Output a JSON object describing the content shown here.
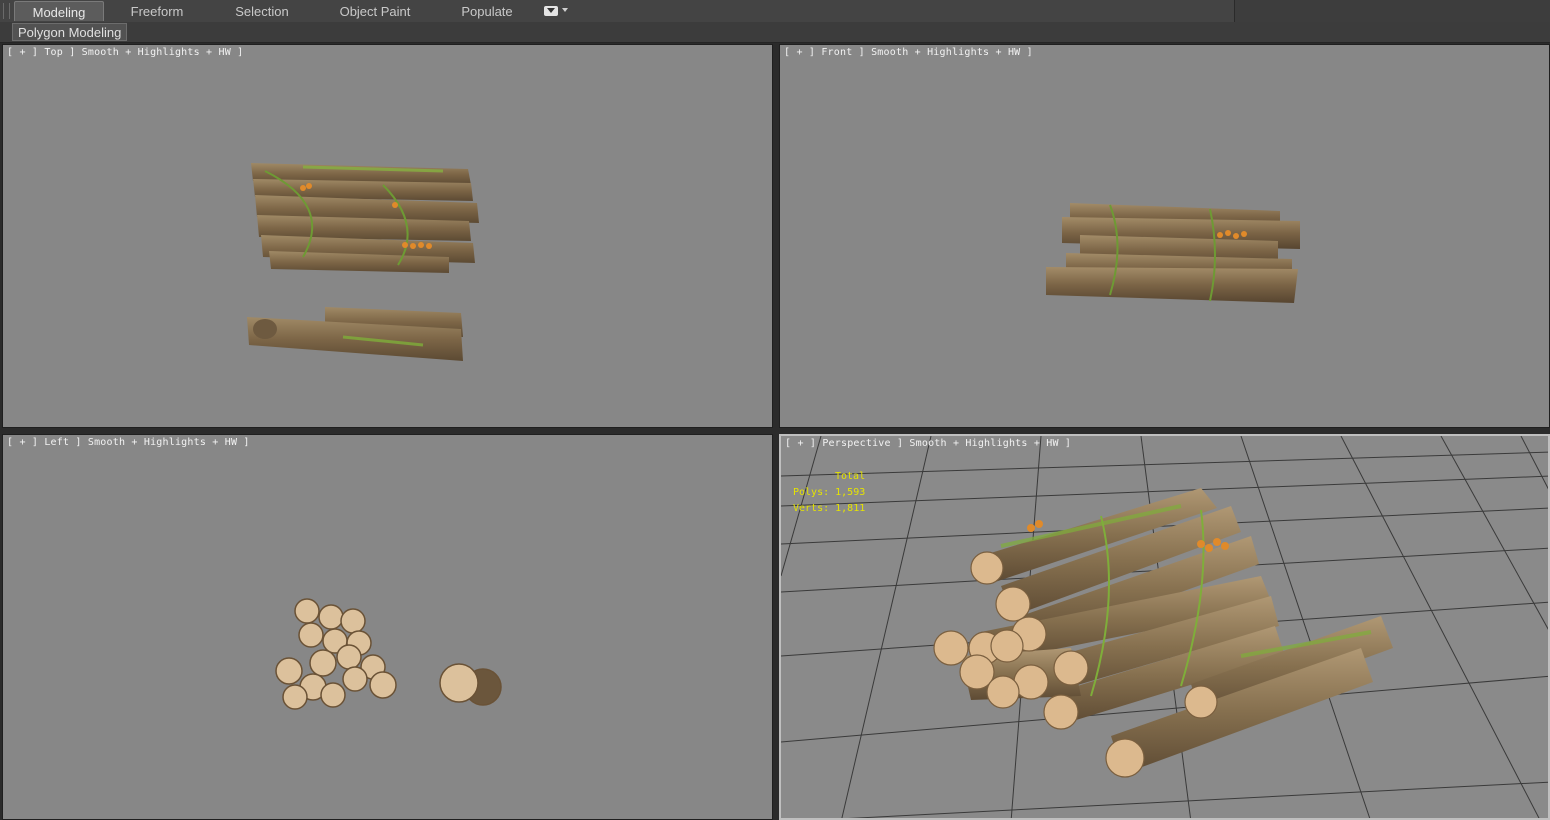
{
  "ribbon": {
    "tabs": [
      {
        "label": "Modeling",
        "active": true
      },
      {
        "label": "Freeform",
        "active": false
      },
      {
        "label": "Selection",
        "active": false
      },
      {
        "label": "Object Paint",
        "active": false
      },
      {
        "label": "Populate",
        "active": false
      }
    ],
    "dropdown_icon": "dropdown-toggle-icon"
  },
  "panel": {
    "label": "Polygon Modeling"
  },
  "viewports": {
    "top": {
      "label": "[ + ] Top ] Smooth + Highlights + HW ]"
    },
    "front": {
      "label": "[ + ] Front ] Smooth + Highlights + HW ]"
    },
    "left": {
      "label": "[ + ] Left ] Smooth + Highlights + HW ]"
    },
    "perspective": {
      "label": "[ + ] Perspective ] Smooth + Highlights + HW ]",
      "stats": {
        "title": "Total",
        "polys": "Polys: 1,593",
        "verts": "Verts: 1,811"
      }
    }
  },
  "colors": {
    "viewport_bg": "#878787",
    "stats_text": "#e6e400",
    "wood_bark": "#8a7556",
    "wood_end": "#d9b48a",
    "moss": "#7fae3a",
    "mushroom": "#e08a2a"
  }
}
